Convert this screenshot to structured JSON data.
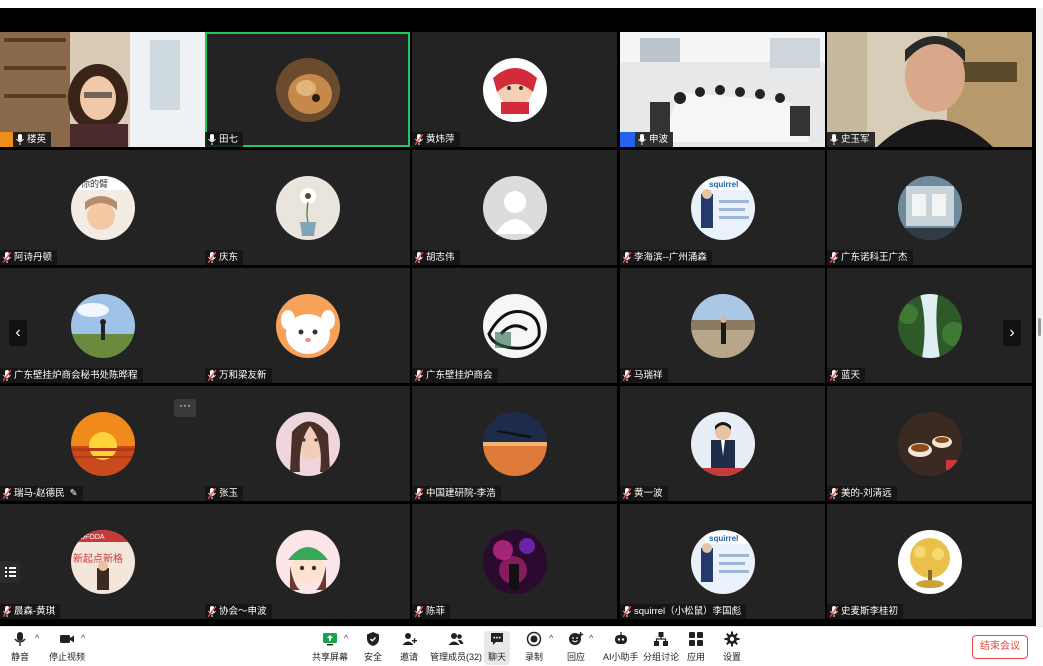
{
  "participants": [
    {
      "name": "楼英",
      "kind": "video",
      "scene": "office-woman",
      "badge": "orange"
    },
    {
      "name": "田七",
      "kind": "avatar",
      "avatar": "dog",
      "active": true
    },
    {
      "name": "黄炜萍",
      "kind": "avatar",
      "avatar": "cartoon-girl"
    },
    {
      "name": "申波",
      "kind": "video",
      "scene": "meeting-room",
      "badge": "blue"
    },
    {
      "name": "史玉军",
      "kind": "video",
      "scene": "man-portrait"
    },
    {
      "name": "阿诗丹顿",
      "kind": "avatar",
      "avatar": "baby-photo"
    },
    {
      "name": "庆东",
      "kind": "avatar",
      "avatar": "flower-vase"
    },
    {
      "name": "胡志伟",
      "kind": "avatar",
      "avatar": "default-user"
    },
    {
      "name": "李海滨--广州涌森",
      "kind": "avatar",
      "avatar": "squirrel-card"
    },
    {
      "name": "广东诺科王广杰",
      "kind": "avatar",
      "avatar": "product-photo"
    },
    {
      "name": "广东壁挂炉商会秘书处陈晔程",
      "kind": "avatar",
      "avatar": "field-sky"
    },
    {
      "name": "万和梁友新",
      "kind": "avatar",
      "avatar": "cute-dog"
    },
    {
      "name": "广东壁挂炉商会",
      "kind": "avatar",
      "avatar": "ink-drawing"
    },
    {
      "name": "马瑞祥",
      "kind": "avatar",
      "avatar": "person-street"
    },
    {
      "name": "蓝天",
      "kind": "avatar",
      "avatar": "waterfall"
    },
    {
      "name": "瑞马-赵德民",
      "kind": "avatar",
      "avatar": "sunset",
      "edit": true
    },
    {
      "name": "张玉",
      "kind": "avatar",
      "avatar": "woman-selfie"
    },
    {
      "name": "中国建研院-李浩",
      "kind": "avatar",
      "avatar": "airplane-dusk"
    },
    {
      "name": "黄一波",
      "kind": "avatar",
      "avatar": "man-suit"
    },
    {
      "name": "美的-刘清远",
      "kind": "avatar",
      "avatar": "tea-cups"
    },
    {
      "name": "晨森-黄琪",
      "kind": "avatar",
      "avatar": "new-start"
    },
    {
      "name": "协会～申波",
      "kind": "avatar",
      "avatar": "cartoon-hat"
    },
    {
      "name": "陈菲",
      "kind": "avatar",
      "avatar": "concert"
    },
    {
      "name": "squirrel（小松鼠）李国彪",
      "kind": "avatar",
      "avatar": "squirrel-card"
    },
    {
      "name": "史麦斯李桂初",
      "kind": "avatar",
      "avatar": "money-tree"
    }
  ],
  "toolbar": {
    "mute": "静音",
    "stop_video": "停止视频",
    "share_screen": "共享屏幕",
    "security": "安全",
    "invite": "邀请",
    "manage_participants": "管理成员(32)",
    "chat": "聊天",
    "record": "录制",
    "reactions": "回应",
    "ai_assistant": "AI小助手",
    "breakout": "分组讨论",
    "apps": "应用",
    "settings": "设置",
    "end_meeting": "结束会议"
  },
  "navigation": {
    "prev": "‹",
    "next": "›",
    "more": "···"
  },
  "colors": {
    "active_border": "#22c55e",
    "end_red": "#e8483e",
    "tile_bg": "#232323",
    "stage_bg": "#000000"
  }
}
